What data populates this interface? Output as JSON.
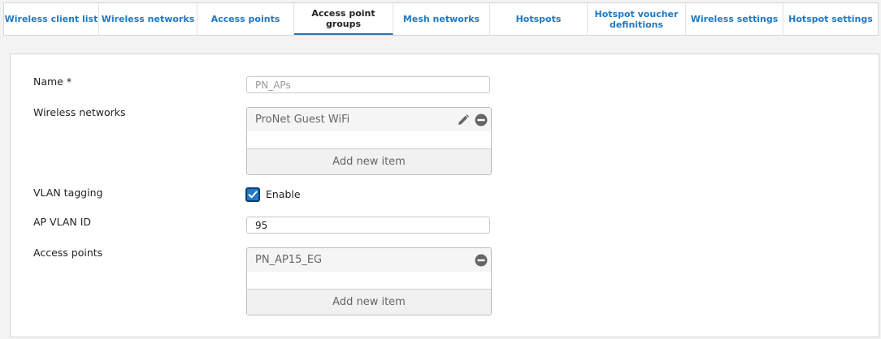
{
  "tabs": [
    {
      "label": "Wireless client list",
      "active": false
    },
    {
      "label": "Wireless networks",
      "active": false
    },
    {
      "label": "Access points",
      "active": false
    },
    {
      "label": "Access point groups",
      "active": true
    },
    {
      "label": "Mesh networks",
      "active": false
    },
    {
      "label": "Hotspots",
      "active": false
    },
    {
      "label": "Hotspot voucher definitions",
      "active": false
    },
    {
      "label": "Wireless settings",
      "active": false
    },
    {
      "label": "Hotspot settings",
      "active": false
    }
  ],
  "form": {
    "name": {
      "label": "Name *",
      "value": "",
      "placeholder": "PN_APs"
    },
    "wireless_networks": {
      "label": "Wireless networks",
      "items": [
        "ProNet Guest WiFi"
      ],
      "add_label": "Add new item"
    },
    "vlan_tagging": {
      "label": "VLAN tagging",
      "checkbox_label": "Enable",
      "checked": true
    },
    "ap_vlan_id": {
      "label": "AP VLAN ID",
      "value": "95"
    },
    "access_points": {
      "label": "Access points",
      "items": [
        "PN_AP15_EG"
      ],
      "add_label": "Add new item"
    }
  },
  "icons": {
    "edit": "pencil-icon",
    "remove": "minus-circle-icon",
    "check": "checkmark-icon"
  },
  "colors": {
    "link_blue": "#1f79c4",
    "checkbox_border": "#0c3f70",
    "icon_gray": "#666666"
  }
}
